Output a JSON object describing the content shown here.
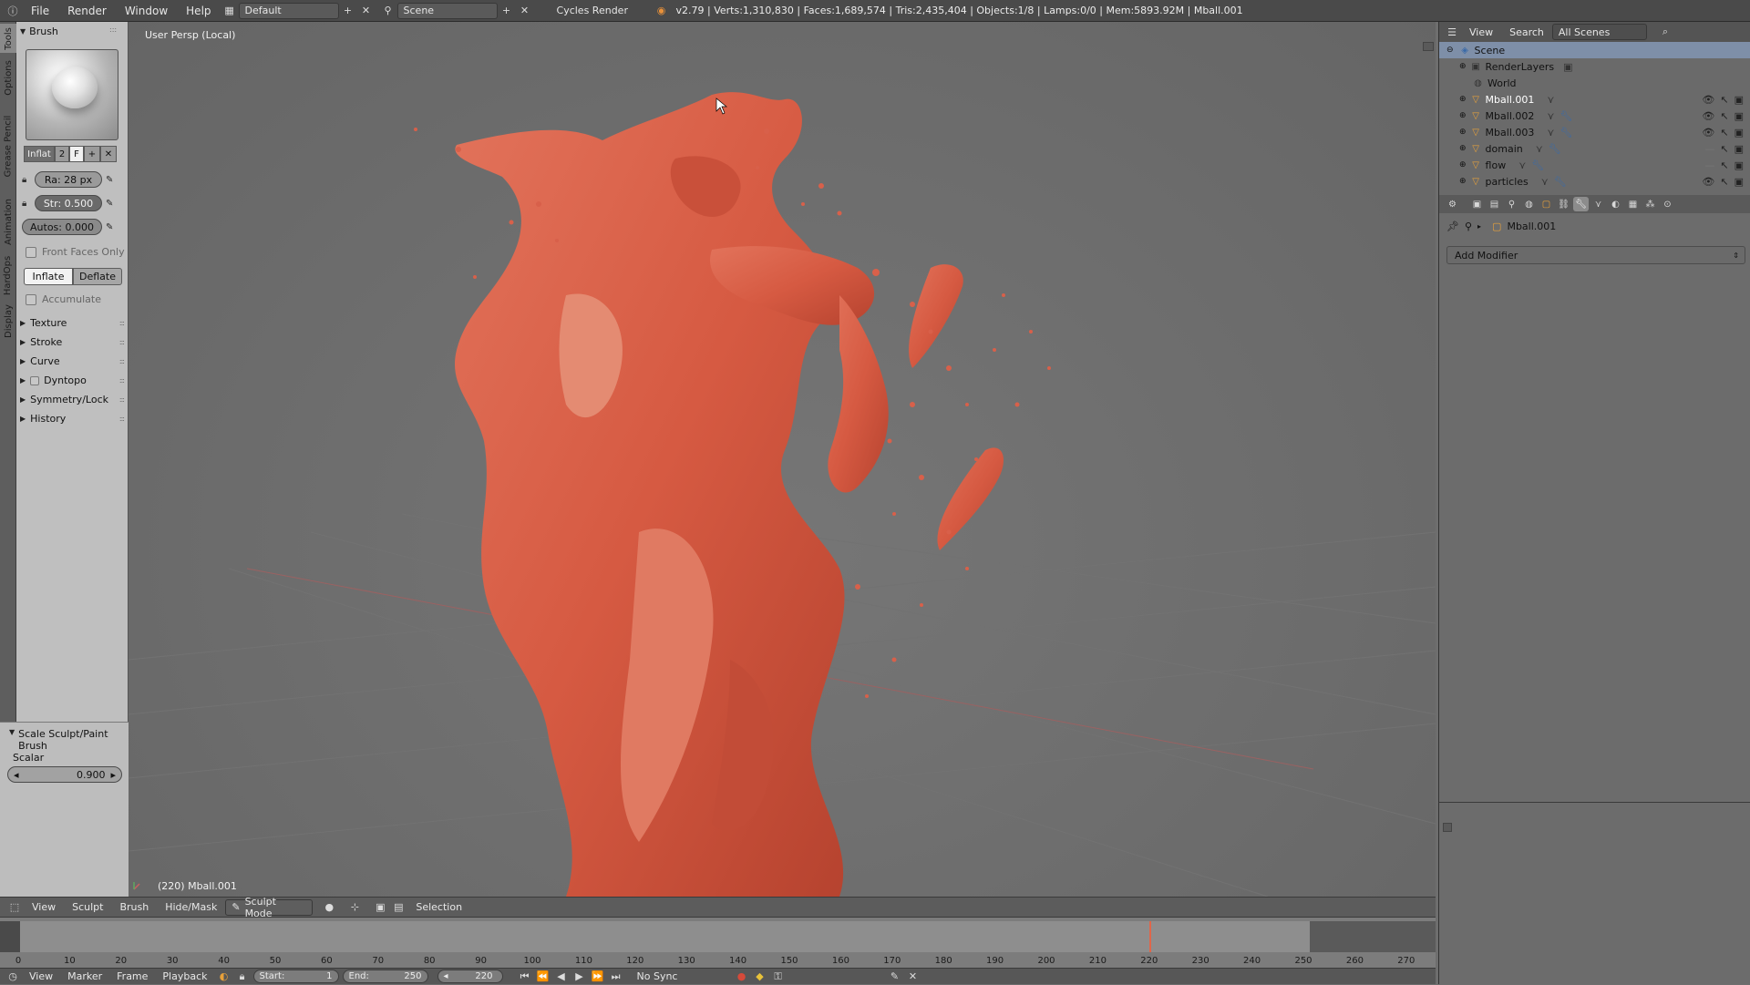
{
  "topbar": {
    "menus": [
      "File",
      "Render",
      "Window",
      "Help"
    ],
    "layout": "Default",
    "scene": "Scene",
    "engine": "Cycles Render",
    "stats": "v2.79 | Verts:1,310,830 | Faces:1,689,574 | Tris:2,435,404 | Objects:1/8 | Lamps:0/0 | Mem:5893.92M | Mball.001"
  },
  "vtabs": [
    "Tools",
    "Options",
    "Grease Pencil",
    "Animation",
    "HardOps",
    "Display"
  ],
  "toolshelf": {
    "brush_header": "Brush",
    "brush_name": "Inflat",
    "brush_users": "2",
    "fake_user": "F",
    "radius": "Ra: 28 px",
    "strength": "Str: 0.500",
    "autosmooth": "Autos:  0.000",
    "front_faces": "Front Faces Only",
    "inflate": "Inflate",
    "deflate": "Deflate",
    "accumulate": "Accumulate",
    "panels": [
      "Texture",
      "Stroke",
      "Curve",
      "Dyntopo",
      "Symmetry/Lock",
      "History"
    ],
    "operator_header": "Scale Sculpt/Paint Brush",
    "scalar_label": "Scalar",
    "scalar_value": "0.900"
  },
  "viewport": {
    "title": "User Persp (Local)",
    "object_info": "(220) Mball.001"
  },
  "viewport_header": {
    "menus": [
      "View",
      "Sculpt",
      "Brush",
      "Hide/Mask"
    ],
    "mode": "Sculpt Mode",
    "selection": "Selection"
  },
  "timeline": {
    "ticks": [
      "0",
      "10",
      "20",
      "30",
      "40",
      "50",
      "60",
      "70",
      "80",
      "90",
      "100",
      "110",
      "120",
      "130",
      "140",
      "150",
      "160",
      "170",
      "180",
      "190",
      "200",
      "210",
      "220",
      "230",
      "240",
      "250",
      "260",
      "270"
    ],
    "current_frame": 220
  },
  "bottombar": {
    "menus": [
      "View",
      "Marker",
      "Frame",
      "Playback"
    ],
    "start_label": "Start:",
    "start_value": "1",
    "end_label": "End:",
    "end_value": "250",
    "frame_value": "220",
    "sync": "No Sync"
  },
  "outliner": {
    "menus": [
      "View",
      "Search"
    ],
    "scenes_dropdown": "All Scenes",
    "items": [
      "Scene",
      "RenderLayers",
      "World",
      "Mball.001",
      "Mball.002",
      "Mball.003",
      "domain",
      "flow",
      "particles"
    ]
  },
  "properties": {
    "object": "Mball.001",
    "add_modifier": "Add Modifier"
  },
  "colors": {
    "fluid": "#d95a44",
    "active_item": "#ffffff",
    "frame_cursor": "#e0664a"
  }
}
